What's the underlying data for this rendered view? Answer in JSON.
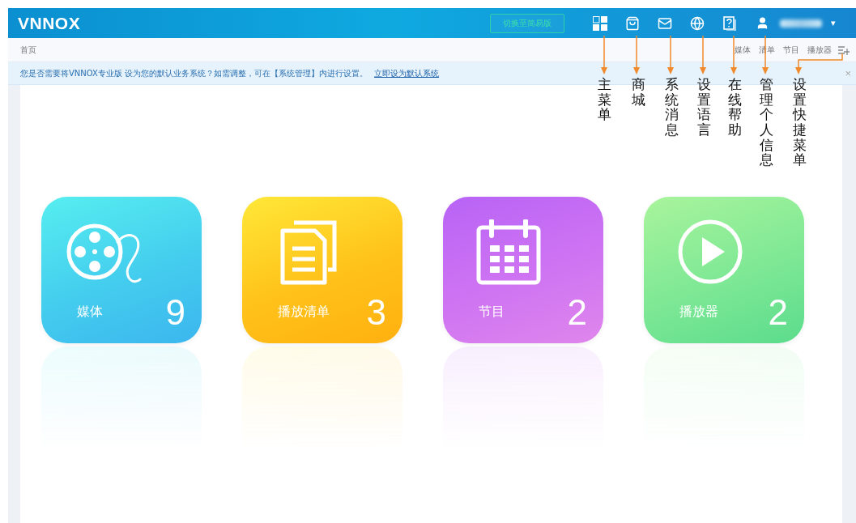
{
  "header": {
    "logo": "VNNOX",
    "switch_button": "切换至简易版",
    "user_caret": "▾"
  },
  "breadcrumb": "首页",
  "quick_links": [
    "媒体",
    "清单",
    "节目",
    "播放器"
  ],
  "notice": {
    "text": "您是否需要将VNNOX专业版 设为您的默认业务系统？如需调整，可在【系统管理】内进行设置。",
    "link": "立即设为默认系统",
    "close": "×"
  },
  "cards": [
    {
      "kind": "media",
      "label": "媒体",
      "count": "9"
    },
    {
      "kind": "playlist",
      "label": "播放清单",
      "count": "3"
    },
    {
      "kind": "program",
      "label": "节目",
      "count": "2"
    },
    {
      "kind": "player",
      "label": "播放器",
      "count": "2"
    }
  ],
  "annotations": [
    "主菜单",
    "商城",
    "系统消息",
    "设置语言",
    "在线帮助",
    "管理个人信息",
    "设置快捷菜单"
  ]
}
